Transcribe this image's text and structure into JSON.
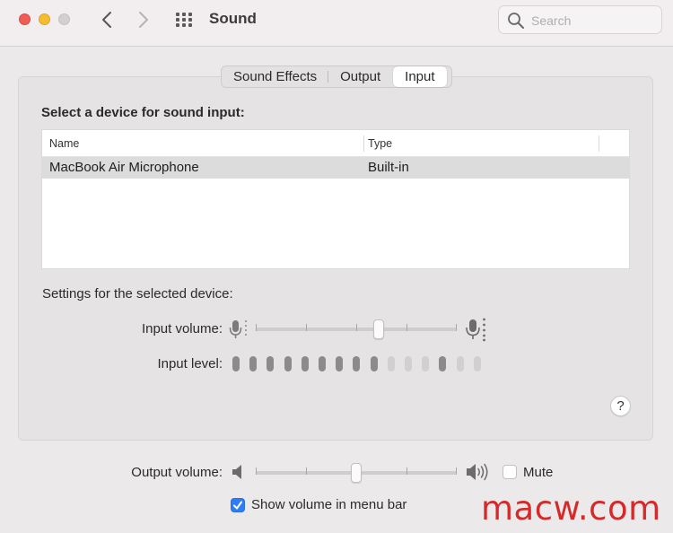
{
  "window": {
    "title": "Sound",
    "search_placeholder": "Search"
  },
  "tabs": [
    {
      "label": "Sound Effects",
      "active": false
    },
    {
      "label": "Output",
      "active": false
    },
    {
      "label": "Input",
      "active": true
    }
  ],
  "input": {
    "heading": "Select a device for sound input:",
    "columns": [
      "Name",
      "Type"
    ],
    "devices": [
      {
        "name": "MacBook Air Microphone",
        "type": "Built-in",
        "selected": true
      }
    ],
    "settings_label": "Settings for the selected device:",
    "volume_label": "Input volume:",
    "volume_level": 0.61,
    "level_label": "Input level:",
    "level_bars": [
      1,
      1,
      1,
      1,
      1,
      1,
      1,
      1,
      1,
      0,
      0,
      0,
      1,
      0,
      0
    ]
  },
  "help_label": "?",
  "output": {
    "volume_label": "Output volume:",
    "volume_level": 0.5,
    "mute_label": "Mute",
    "mute_checked": false,
    "show_in_menubar_label": "Show volume in menu bar",
    "show_in_menubar_checked": true
  },
  "watermark": "macw.com",
  "colors": {
    "accent": "#2f7df6",
    "level_on": "#8c8a8b",
    "level_off": "#d1cfd0",
    "close": "#ee5e57",
    "minimize": "#f5bd2e"
  }
}
